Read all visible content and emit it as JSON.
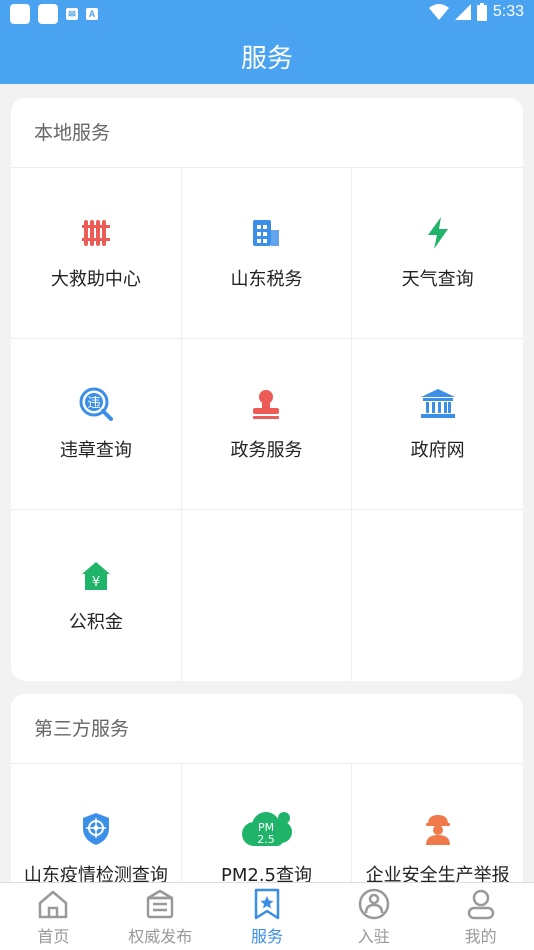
{
  "status_bar": {
    "time": "5:33",
    "left_icons": [
      "app-icon",
      "app-icon",
      "mail-icon",
      "font-icon"
    ],
    "right_icons": [
      "wifi-icon",
      "signal-icon",
      "battery-icon"
    ]
  },
  "header": {
    "title": "服务"
  },
  "local_services": {
    "title": "本地服务",
    "items": [
      {
        "label": "大救助中心",
        "icon": "radiator-icon"
      },
      {
        "label": "山东税务",
        "icon": "building-icon"
      },
      {
        "label": "天气查询",
        "icon": "lightning-icon"
      },
      {
        "label": "违章查询",
        "icon": "traffic-violation-icon"
      },
      {
        "label": "政务服务",
        "icon": "stamp-icon"
      },
      {
        "label": "政府网",
        "icon": "government-building-icon"
      },
      {
        "label": "公积金",
        "icon": "house-fund-icon"
      }
    ]
  },
  "third_party_services": {
    "title": "第三方服务",
    "items": [
      {
        "label": "山东疫情检测查询",
        "icon": "shield-target-icon"
      },
      {
        "label": "PM2.5查询",
        "icon": "pm25-cloud-icon",
        "icon_text": [
          "PM",
          "2.5"
        ]
      },
      {
        "label": "企业安全生产举报",
        "icon": "safety-worker-icon"
      }
    ]
  },
  "tabbar": {
    "items": [
      {
        "label": "首页",
        "icon": "home-icon",
        "active": false
      },
      {
        "label": "权威发布",
        "icon": "news-icon",
        "active": false
      },
      {
        "label": "服务",
        "icon": "bookmark-star-icon",
        "active": true
      },
      {
        "label": "入驻",
        "icon": "enter-icon",
        "active": false
      },
      {
        "label": "我的",
        "icon": "user-icon",
        "active": false
      }
    ]
  },
  "colors": {
    "primary": "#4aa3f0",
    "active_tab": "#3a8ee6",
    "red": "#ec5b56",
    "green": "#1fb46a",
    "blue": "#3b8fe8",
    "orange": "#f07a4a"
  }
}
